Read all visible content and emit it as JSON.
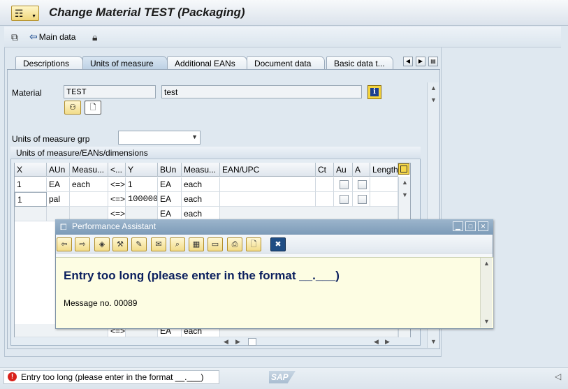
{
  "window": {
    "title": "Change Material TEST (Packaging)"
  },
  "toolbar": {
    "main_data_label": "Main data"
  },
  "tabs": [
    {
      "label": "Descriptions",
      "active": false
    },
    {
      "label": "Units of measure",
      "active": true
    },
    {
      "label": "Additional EANs",
      "active": false
    },
    {
      "label": "Document data",
      "active": false
    },
    {
      "label": "Basic data t...",
      "active": false
    }
  ],
  "header": {
    "material_label": "Material",
    "material_value": "TEST",
    "material_desc": "test",
    "uom_group_label": "Units of measure grp",
    "uom_group_value": ""
  },
  "group": {
    "title": "Units of measure/EANs/dimensions"
  },
  "table": {
    "columns": [
      "X",
      "AUn",
      "Measu...",
      "<...",
      "Y",
      "BUn",
      "Measu...",
      "EAN/UPC",
      "Ct",
      "Au",
      "A",
      "Length"
    ],
    "rows": [
      {
        "x": "1",
        "aun": "EA",
        "meas": "each",
        "lt": "<=>",
        "y": "1",
        "bun": "EA",
        "meas2": "each"
      },
      {
        "x": "1",
        "aun": "pal",
        "meas": "",
        "lt": "<=>",
        "y": "100000",
        "bun": "EA",
        "meas2": "each"
      },
      {
        "x": "",
        "aun": "",
        "meas": "",
        "lt": "<=>",
        "y": "",
        "bun": "EA",
        "meas2": "each"
      }
    ],
    "bottom_row": {
      "lt": "<=>",
      "bun": "EA",
      "meas2": "each"
    }
  },
  "popup": {
    "title": "Performance Assistant",
    "headline": "Entry too long (please enter in the format __.___)",
    "message": "Message no. 00089"
  },
  "status": {
    "message": "Entry too long (please enter in the format __.___)",
    "type": "error",
    "logo": "SAP"
  },
  "colors": {
    "error": "#d9221c",
    "headline": "#0b1f5e",
    "popup_title_bg": "#7d9bb8"
  }
}
